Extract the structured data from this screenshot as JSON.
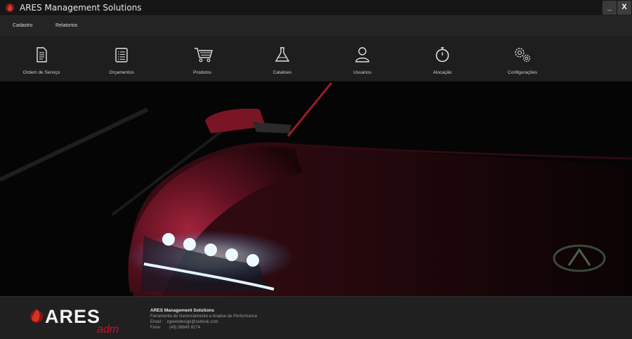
{
  "window": {
    "title": "ARES Management Solutions",
    "minimize_label": "_",
    "close_label": "X"
  },
  "menu": {
    "items": [
      {
        "label": "Cadastro"
      },
      {
        "label": "Relatorios"
      }
    ]
  },
  "toolbar": {
    "items": [
      {
        "label": "Ordem de Serviço",
        "icon": "document-icon"
      },
      {
        "label": "Orçamentos",
        "icon": "list-document-icon"
      },
      {
        "label": "Produtos",
        "icon": "shopping-cart-icon"
      },
      {
        "label": "Catalises",
        "icon": "flask-icon"
      },
      {
        "label": "Usuarios",
        "icon": "user-icon"
      },
      {
        "label": "Alocação",
        "icon": "stopwatch-icon"
      },
      {
        "label": "Configurações",
        "icon": "gears-icon"
      }
    ]
  },
  "footer": {
    "logo_text": "ARES",
    "logo_subtext": "adm",
    "info_title": "ARES Management Solutions",
    "info_lines": [
      "Ferramenta de Gerenciamento e Analise de Performance",
      "Email :   zgwebdesign@outlook.com",
      "Fone:       (49) 98845 8174"
    ]
  },
  "colors": {
    "accent": "#c8102e",
    "titlebar": "#161616",
    "toolbar": "#1e1e1e"
  }
}
